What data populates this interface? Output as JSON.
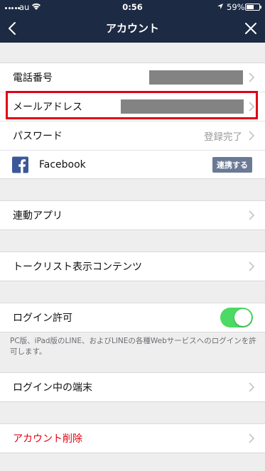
{
  "status_bar": {
    "carrier": "au",
    "time": "0:56",
    "battery": "59%",
    "battery_level": 0.59
  },
  "nav": {
    "title": "アカウント",
    "back_icon": "chevron-left-icon",
    "close_icon": "close-icon"
  },
  "account": {
    "phone_label": "電話番号",
    "email_label": "メールアドレス",
    "password_label": "パスワード",
    "password_status": "登録完了",
    "facebook_label": "Facebook",
    "facebook_action": "連携する"
  },
  "apps_label": "連動アプリ",
  "talklist_label": "トークリスト表示コンテンツ",
  "login": {
    "permission_label": "ログイン許可",
    "permission_enabled": true,
    "note": "PC版、iPad版のLINE、およびLINEの各種Webサービスへのログインを許可します。",
    "devices_label": "ログイン中の端末"
  },
  "delete_label": "アカウント削除",
  "colors": {
    "header": "#1d2a43",
    "danger": "#e4000f",
    "toggle_on": "#4cd964",
    "highlight_frame": "#e10019",
    "facebook": "#3b5998"
  }
}
